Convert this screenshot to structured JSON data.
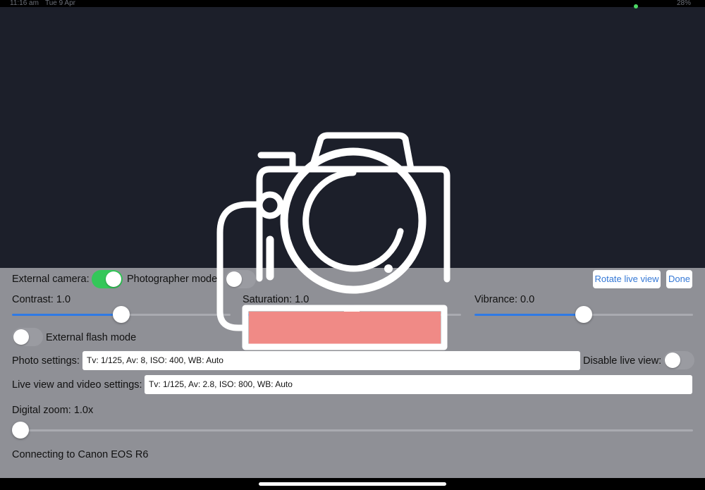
{
  "status_bar": {
    "time": "11:16 am",
    "date": "Tue 9 Apr",
    "right": "28%"
  },
  "controls": {
    "external_camera_label": "External camera:",
    "external_camera_on": true,
    "photographer_mode_label": "Photographer mode:",
    "photographer_mode_on": false,
    "rotate_live_view_label": "Rotate live view",
    "done_label": "Done",
    "external_flash_label": "External flash mode",
    "external_flash_on": false,
    "photo_settings_label": "Photo settings:",
    "photo_settings_value": "Tv: 1/125, Av: 8, ISO: 400, WB: Auto",
    "disable_live_view_label": "Disable live view:",
    "disable_live_view_on": false,
    "live_view_settings_label": "Live view and video settings:",
    "live_view_settings_value": "Tv: 1/125, Av: 2.8, ISO: 800, WB: Auto",
    "connection_status": "Connecting to Canon EOS R6"
  },
  "sliders": {
    "contrast": {
      "label": "Contrast: 1.0",
      "level": 0.5
    },
    "saturation": {
      "label": "Saturation: 1.0",
      "level": 0.5
    },
    "vibrance": {
      "label": "Vibrance: 0.0",
      "level": 0.5
    },
    "zoom": {
      "label": "Digital zoom: 1.0x",
      "level": 0.0
    }
  },
  "colors": {
    "accent": "#2f7ae5",
    "toggle_on": "#34c759",
    "panel": "#8f9096",
    "viewfinder": "#1c1f2a",
    "overlay_red": "#f08a86"
  },
  "icons": {
    "overlay": "camera-icon"
  }
}
